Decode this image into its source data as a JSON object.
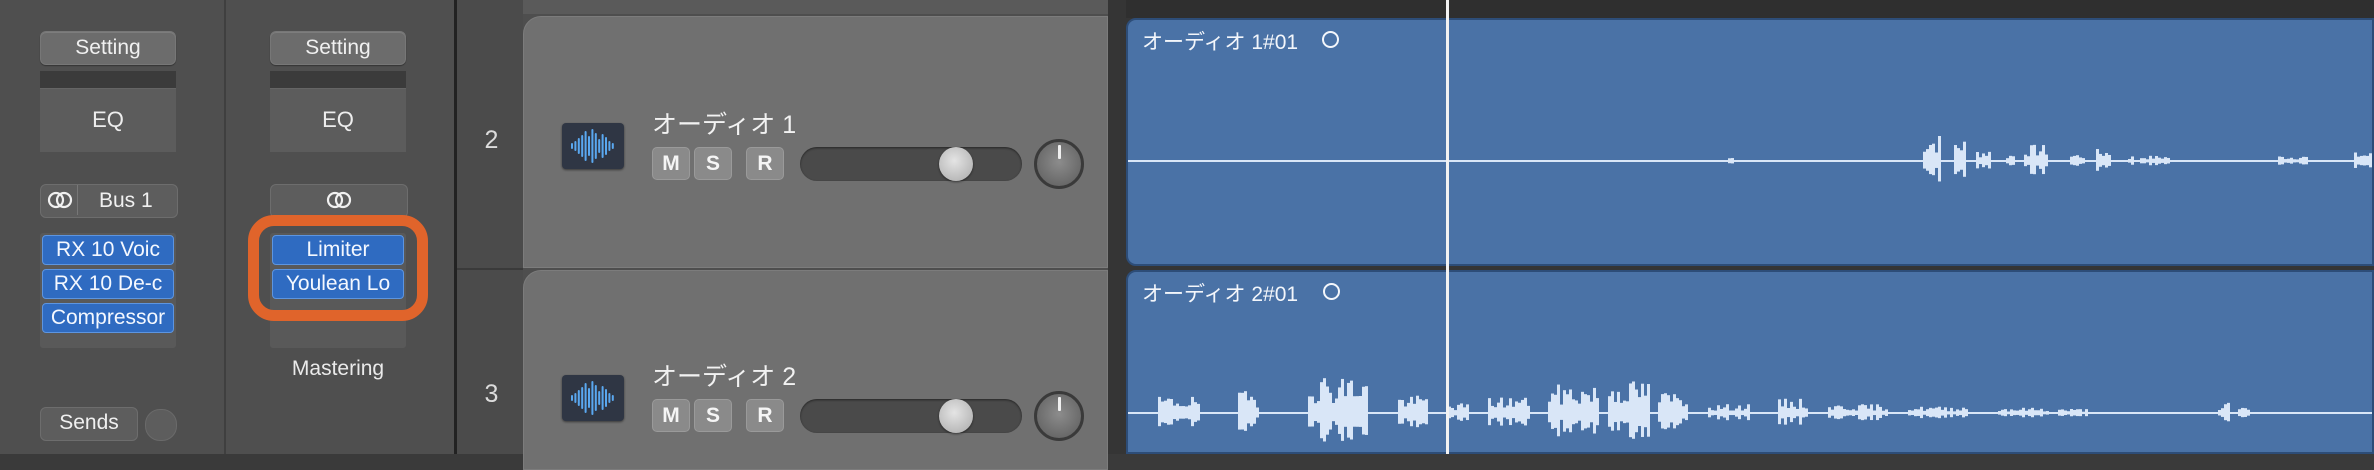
{
  "mixer": {
    "strip1": {
      "setting_label": "Setting",
      "eq_label": "EQ",
      "send_label": "Bus 1",
      "plugins": [
        "RX 10 Voic",
        "RX 10 De-c",
        "Compressor"
      ],
      "sends_label": "Sends"
    },
    "strip2": {
      "setting_label": "Setting",
      "eq_label": "EQ",
      "plugins": [
        "Limiter",
        "Youlean Lo"
      ],
      "name": "Mastering"
    },
    "highlight_color": "#e0642b"
  },
  "tracks": [
    {
      "number": "2",
      "name": "オーディオ 1",
      "mute": "M",
      "solo": "S",
      "record": "R",
      "volume_fraction": 0.74,
      "region_title": "オーディオ 1#01"
    },
    {
      "number": "3",
      "name": "オーディオ 2",
      "mute": "M",
      "solo": "S",
      "record": "R",
      "volume_fraction": 0.74,
      "region_title": "オーディオ 2#01"
    }
  ],
  "icons": {
    "link": "link-icon",
    "waveform": "audio-waveform-icon",
    "loop": "loop-circle-icon",
    "pan": "pan-knob"
  },
  "colors": {
    "plugin_blue": "#2f6bc1",
    "region_blue": "#4a72a6",
    "waveform": "#d9e6f7"
  }
}
